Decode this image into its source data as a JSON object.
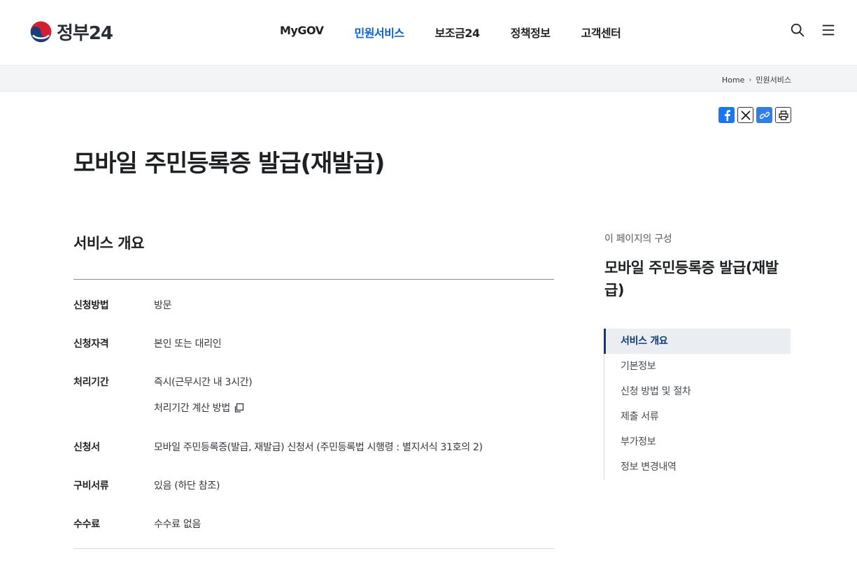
{
  "header": {
    "logo_text": "정부24",
    "nav": [
      "MyGOV",
      "민원서비스",
      "보조금24",
      "정책정보",
      "고객센터"
    ],
    "active_nav": "민원서비스",
    "search_icon": "search-icon",
    "menu_icon": "hamburger-menu-icon"
  },
  "breadcrumb": {
    "home": "Home",
    "current": "민원서비스"
  },
  "share": {
    "icons": [
      "facebook-icon",
      "x-icon",
      "link-icon",
      "print-icon"
    ]
  },
  "page": {
    "title": "모바일 주민등록증 발급(재발급)"
  },
  "overview": {
    "title": "서비스 개요",
    "rows": [
      {
        "label": "신청방법",
        "value": "방문"
      },
      {
        "label": "신청자격",
        "value": "본인 또는 대리인"
      },
      {
        "label": "처리기간",
        "value": "즉시(근무시간 내 3시간)"
      },
      {
        "label": "신청서",
        "value": "모바일 주민등록증(발급, 재발급) 신청서 (주민등록법 시행령 : 별지서식 31호의 2)"
      },
      {
        "label": "구비서류",
        "value": "있음 (하단 참조)"
      },
      {
        "label": "수수료",
        "value": "수수료 없음"
      }
    ],
    "period_calc_link": "처리기간 계산 방법"
  },
  "toc": {
    "caption": "이 페이지의 구성",
    "title": "모바일 주민등록증 발급(재발급)",
    "items": [
      "서비스 개요",
      "기본정보",
      "신청 방법 및 절차",
      "제출 서류",
      "부가정보",
      "정보 변경내역"
    ],
    "active_item": "서비스 개요"
  },
  "colors": {
    "accent": "#0b62c9",
    "toc_active": "#0d3b74",
    "crumb_bg": "#f2f4f6"
  }
}
